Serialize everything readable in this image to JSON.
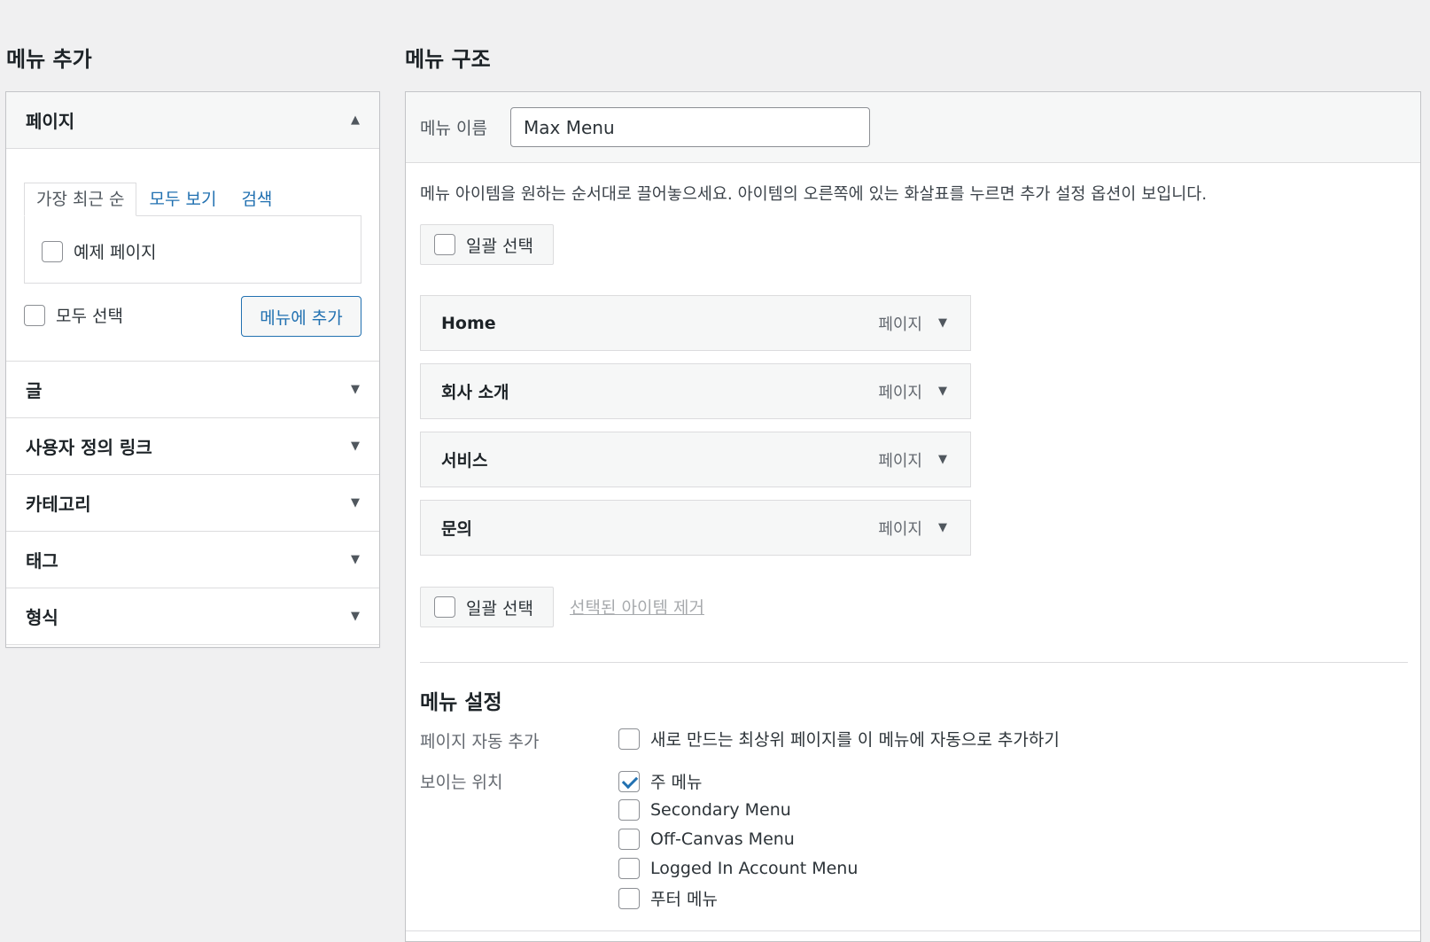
{
  "add_menu": {
    "title": "메뉴 추가",
    "pages": {
      "label": "페이지",
      "tabs": [
        "가장 최근 순",
        "모두 보기",
        "검색"
      ],
      "items": [
        "예제 페이지"
      ],
      "select_all": "모두 선택",
      "add_button": "메뉴에 추가"
    },
    "sections": [
      "글",
      "사용자 정의 링크",
      "카테고리",
      "태그",
      "형식"
    ]
  },
  "structure": {
    "title": "메뉴 구조",
    "name_label": "메뉴 이름",
    "name_value": "Max Menu",
    "instructions": "메뉴 아이템을 원하는 순서대로 끌어놓으세요. 아이템의 오른쪽에 있는 화살표를 누르면 추가 설정 옵션이 보입니다.",
    "bulk_select": "일괄 선택",
    "remove_selected": "선택된 아이템 제거",
    "items": [
      {
        "title": "Home",
        "type": "페이지"
      },
      {
        "title": "회사 소개",
        "type": "페이지"
      },
      {
        "title": "서비스",
        "type": "페이지"
      },
      {
        "title": "문의",
        "type": "페이지"
      }
    ]
  },
  "settings": {
    "title": "메뉴 설정",
    "auto_add_label": "페이지 자동 추가",
    "auto_add_option": "새로 만드는 최상위 페이지를 이 메뉴에 자동으로 추가하기",
    "location_label": "보이는 위치",
    "locations": [
      {
        "label": "주 메뉴",
        "checked": true
      },
      {
        "label": "Secondary Menu",
        "checked": false
      },
      {
        "label": "Off-Canvas Menu",
        "checked": false
      },
      {
        "label": "Logged In Account Menu",
        "checked": false
      },
      {
        "label": "푸터 메뉴",
        "checked": false
      }
    ]
  },
  "icons": {
    "collapse": "triangle-up-icon",
    "expand": "triangle-down-icon"
  }
}
